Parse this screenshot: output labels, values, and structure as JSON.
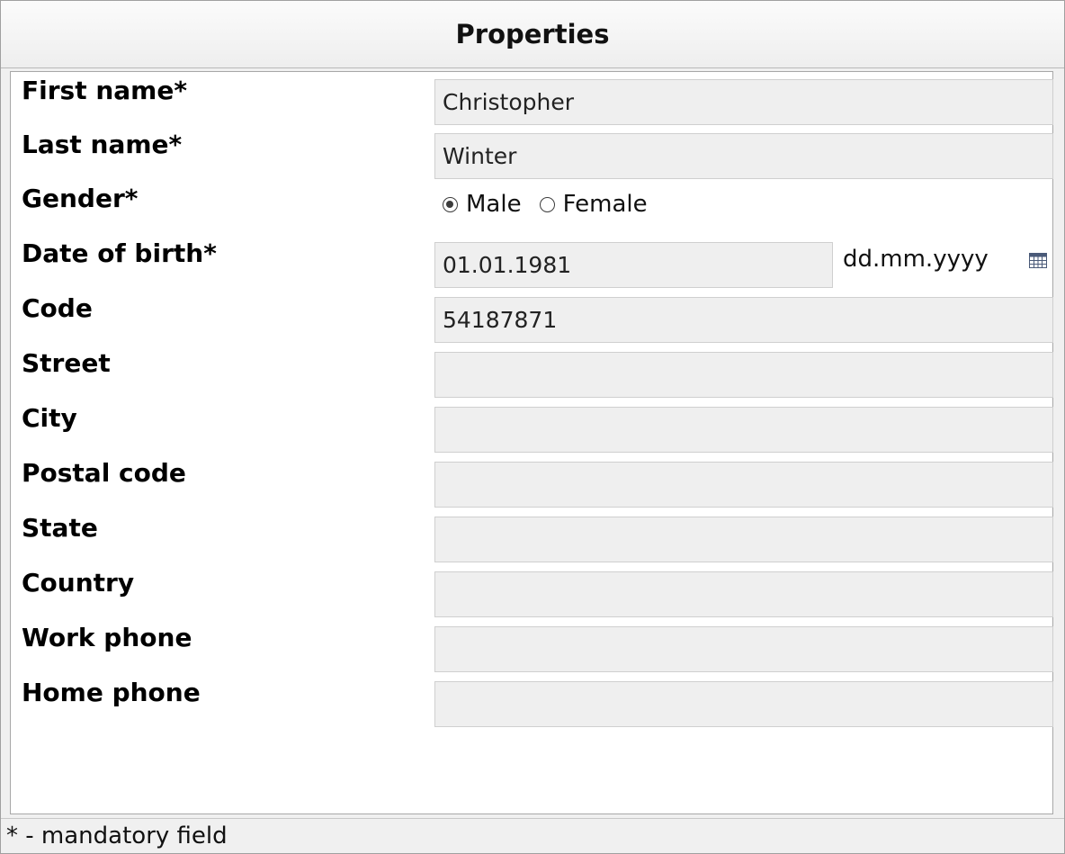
{
  "panel": {
    "title": "Properties",
    "footer_note": "* - mandatory field"
  },
  "fields": {
    "first_name": {
      "label": "First name*",
      "value": "Christopher"
    },
    "last_name": {
      "label": "Last name*",
      "value": "Winter"
    },
    "gender": {
      "label": "Gender*",
      "options": [
        {
          "label": "Male",
          "checked": true
        },
        {
          "label": "Female",
          "checked": false
        }
      ]
    },
    "date_of_birth": {
      "label": "Date of birth*",
      "value": "01.01.1981",
      "format": "dd.mm.yyyy",
      "icon": "calendar-icon"
    },
    "code": {
      "label": "Code",
      "value": "54187871"
    },
    "street": {
      "label": "Street",
      "value": ""
    },
    "city": {
      "label": "City",
      "value": ""
    },
    "postal_code": {
      "label": "Postal code",
      "value": ""
    },
    "state": {
      "label": "State",
      "value": ""
    },
    "country": {
      "label": "Country",
      "value": ""
    },
    "work_phone": {
      "label": "Work phone",
      "value": ""
    },
    "home_phone": {
      "label": "Home phone",
      "value": ""
    }
  },
  "colors": {
    "field_background": "#efefef",
    "panel_background": "#f0f0f0",
    "border": "#a0a0a0"
  }
}
